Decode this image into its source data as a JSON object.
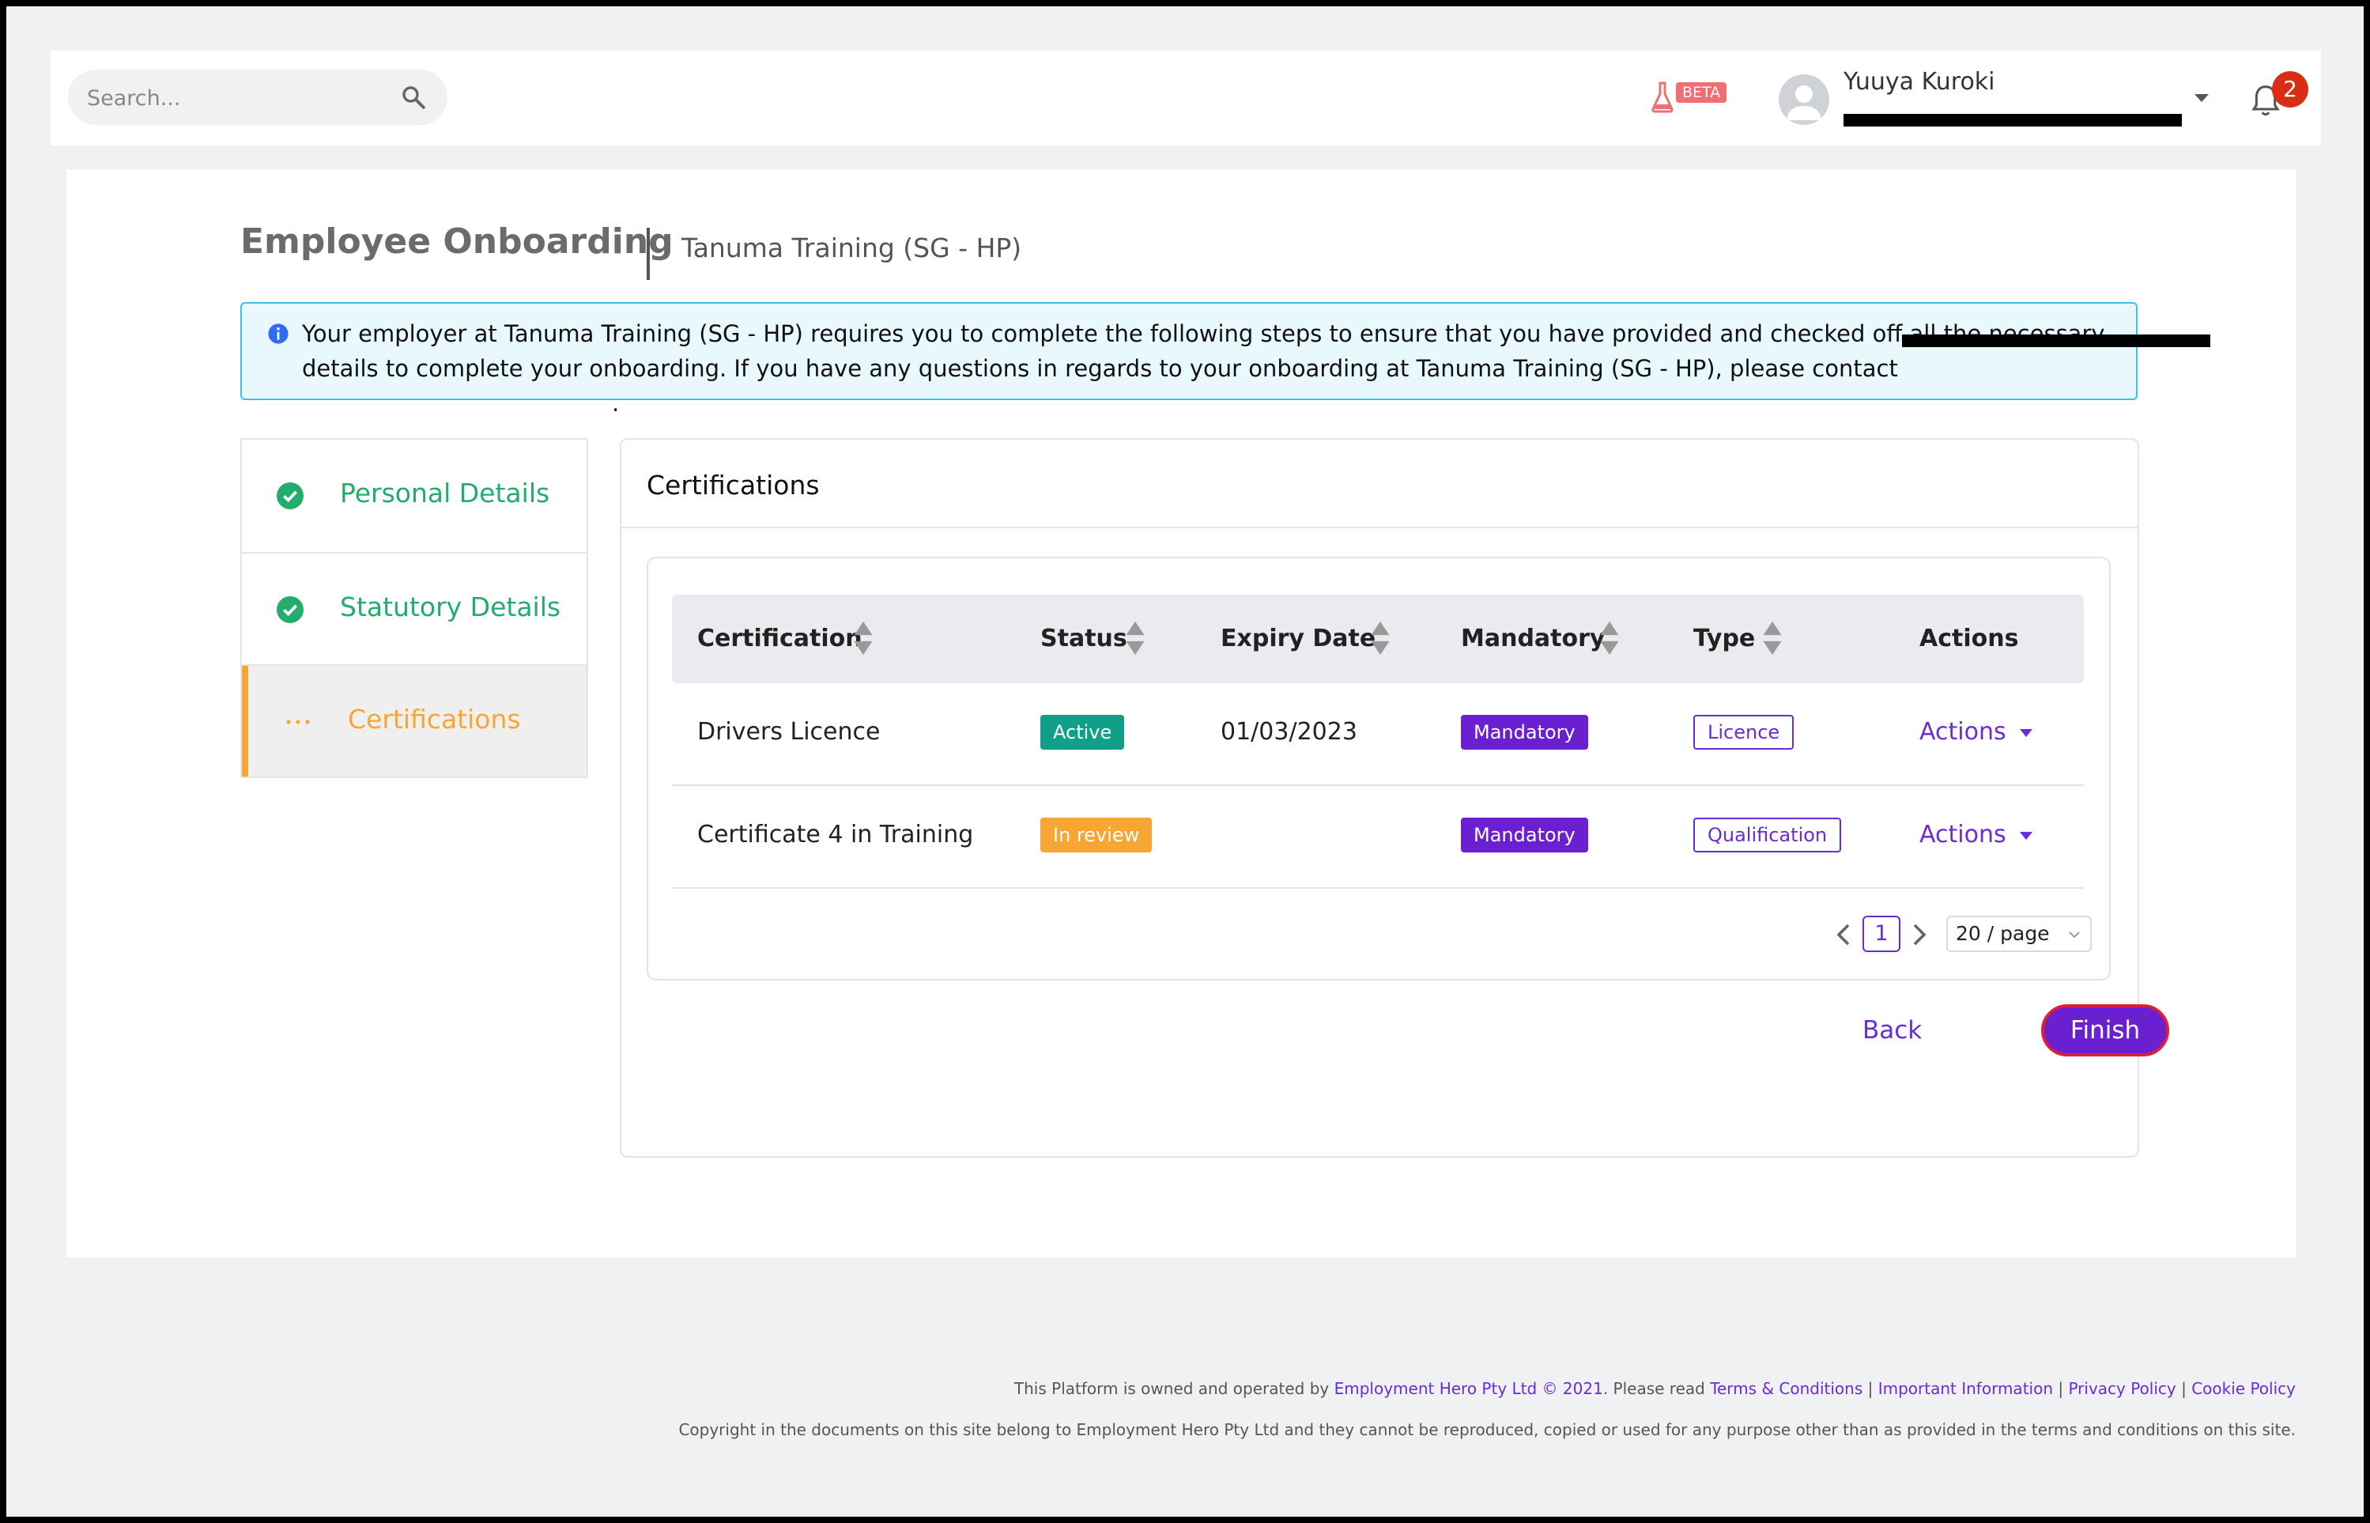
{
  "search": {
    "placeholder": "Search...",
    "icon": "search-icon"
  },
  "header": {
    "beta_label": "BETA",
    "user_name": "Yuuya Kuroki",
    "notifications_count": "2"
  },
  "page": {
    "title": "Employee Onboarding",
    "subtitle": "Tanuma Training (SG - HP)"
  },
  "info_banner": {
    "text": "Your employer at Tanuma Training (SG - HP) requires you to complete the following steps to ensure that you have provided and checked off all the necessary details to complete your onboarding. If you have any questions in regards to your onboarding at Tanuma Training (SG - HP), please contact ",
    "period": "."
  },
  "steps": [
    {
      "label": "Personal Details",
      "status": "complete"
    },
    {
      "label": "Statutory Details",
      "status": "complete"
    },
    {
      "label": "Certifications",
      "status": "in-progress"
    }
  ],
  "panel": {
    "title": "Certifications"
  },
  "table": {
    "columns": [
      "Certification",
      "Status",
      "Expiry Date",
      "Mandatory",
      "Type",
      "Actions"
    ],
    "rows": [
      {
        "certification": "Drivers Licence",
        "status": "Active",
        "expiry": "01/03/2023",
        "mandatory": "Mandatory",
        "type": "Licence",
        "actions": "Actions"
      },
      {
        "certification": "Certificate 4 in Training",
        "status": "In review",
        "expiry": "",
        "mandatory": "Mandatory",
        "type": "Qualification",
        "actions": "Actions"
      }
    ]
  },
  "pagination": {
    "current_page": "1",
    "page_size": "20 / page"
  },
  "buttons": {
    "back": "Back",
    "finish": "Finish"
  },
  "footer": {
    "line1_prefix": "This Platform is owned and operated by ",
    "company_link": "Employment Hero Pty Ltd © 2021",
    "line1_mid": ". Please read ",
    "terms": "Terms & Conditions",
    "important": "Important Information",
    "privacy": "Privacy Policy",
    "cookie": "Cookie Policy",
    "separator": " | ",
    "line2": "Copyright in the documents on this site belong to Employment Hero Pty Ltd and they cannot be reproduced, copied or used for any purpose other than as provided in the terms and conditions on this site."
  },
  "colors": {
    "accent": "#6a1fd1",
    "success": "#23ad6c",
    "warning": "#f7a533",
    "info_border": "#35c3e6",
    "danger": "#d92e16"
  }
}
